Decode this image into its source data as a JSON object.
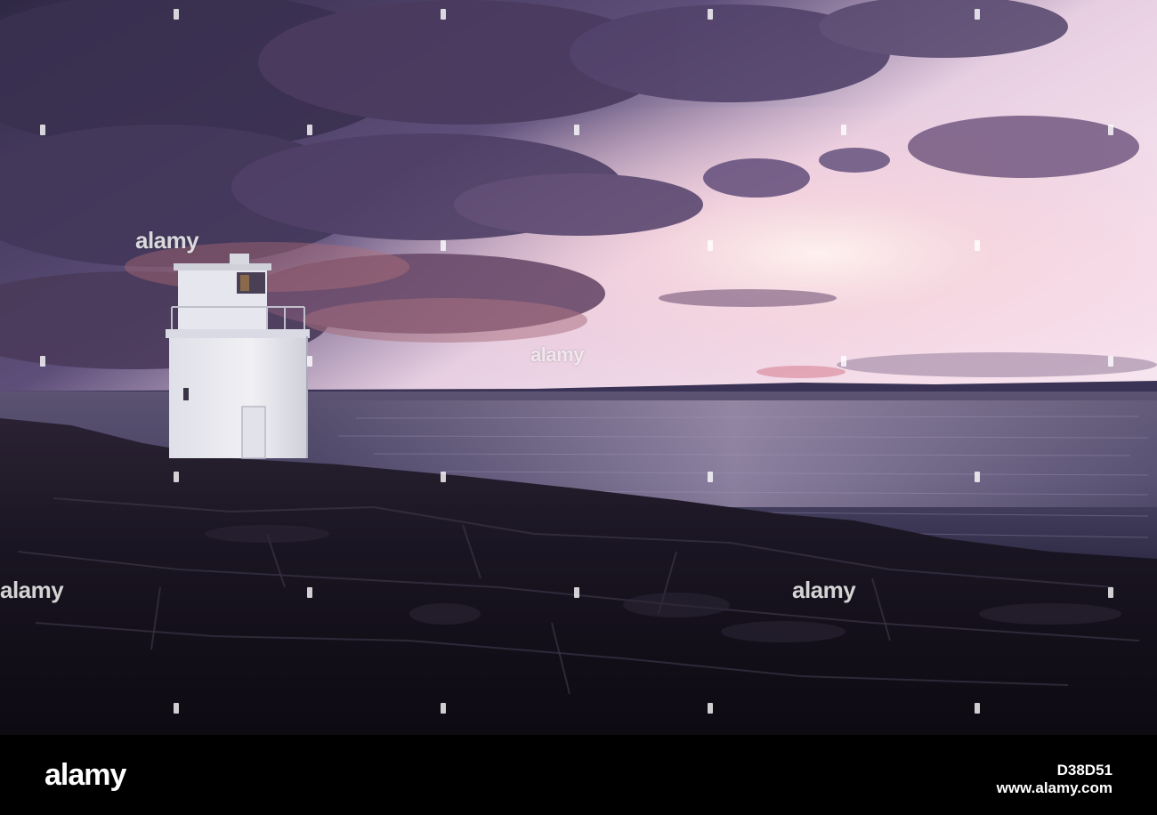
{
  "photo": {
    "subject": "lighthouse-on-rocky-coast-at-sunset",
    "colors": {
      "sky_top": "#3b2f52",
      "sky_glow": "#f6d6e4",
      "horizon": "#f8c9c6",
      "sea": "#4a4664",
      "rocks": "#17121f",
      "lighthouse": "#e8e8ee"
    }
  },
  "watermark": {
    "text": "alamy",
    "brand": "alamy",
    "alt_text": "alamy"
  },
  "footer": {
    "logo": "alamy",
    "image_id": "D38D51",
    "url": "www.alamy.com"
  }
}
